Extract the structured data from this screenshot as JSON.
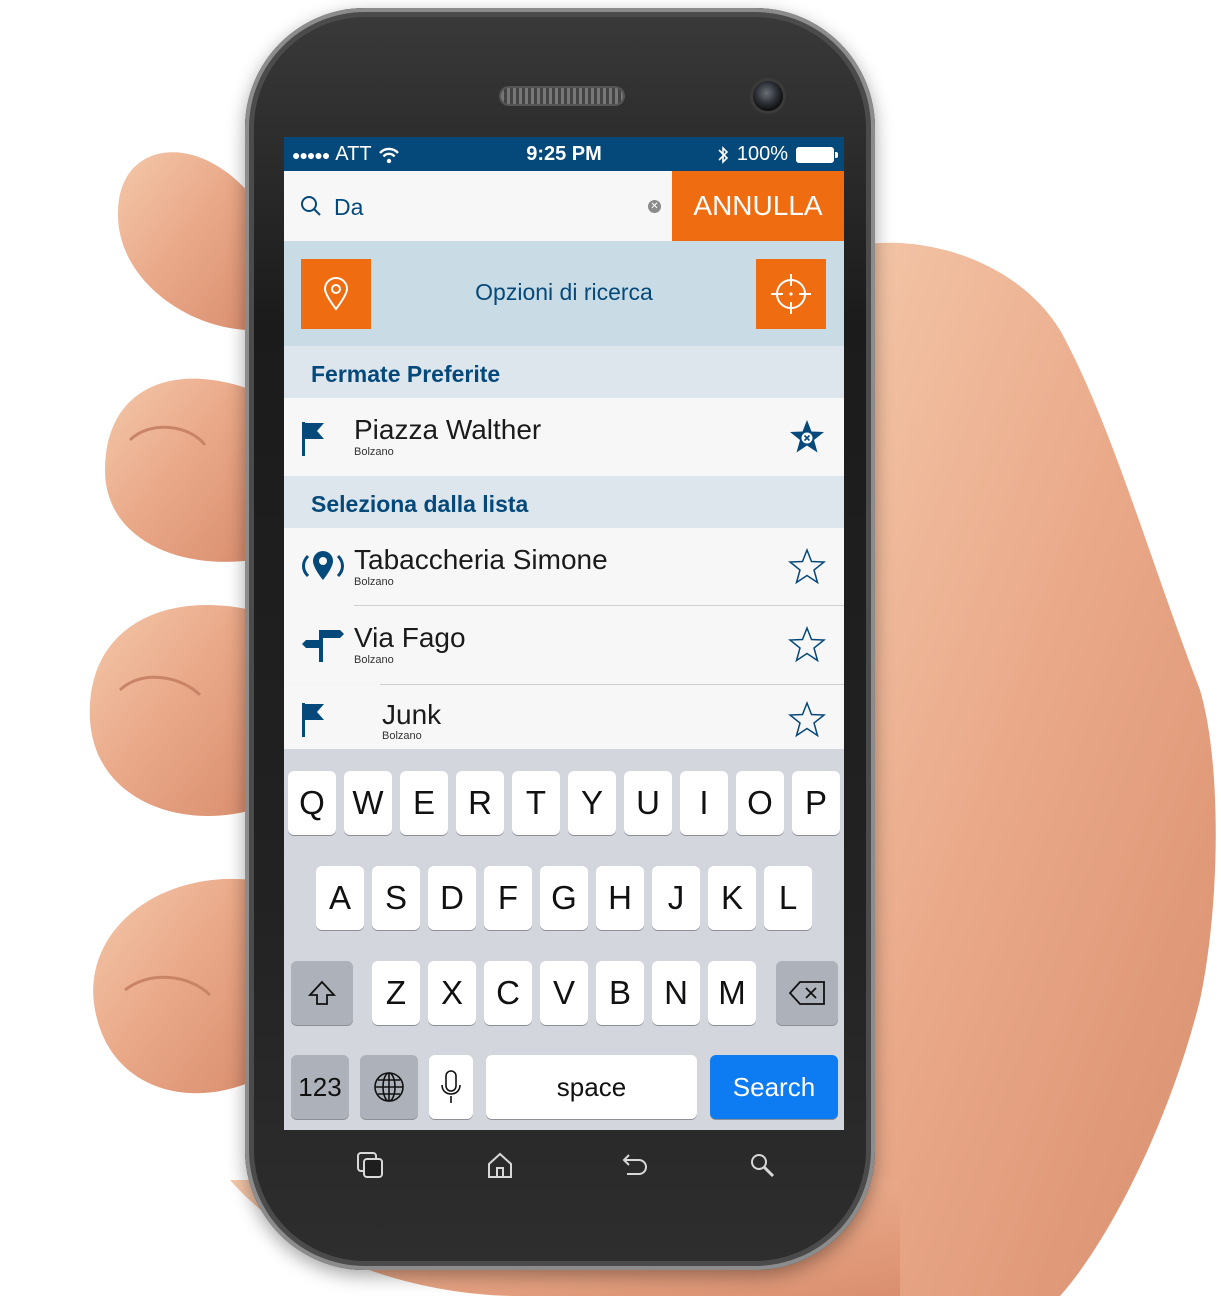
{
  "status_bar": {
    "carrier": "ATT",
    "time": "9:25 PM",
    "battery": "100%"
  },
  "search": {
    "query": "Da",
    "cancel_label": "ANNULLA"
  },
  "search_options": {
    "label": "Opzioni di ricerca"
  },
  "favorites": {
    "header": "Fermate Preferite",
    "items": [
      {
        "title": "Piazza Walther",
        "city": "Bolzano",
        "icon": "flag-icon",
        "starred": true
      }
    ]
  },
  "list": {
    "header": "Seleziona dalla lista",
    "items": [
      {
        "title": "Tabaccheria Simone",
        "city": "Bolzano",
        "icon": "ticket-point-icon"
      },
      {
        "title": "Via Fago",
        "city": "Bolzano",
        "icon": "signpost-icon"
      },
      {
        "title": "Junk",
        "city": "Bolzano",
        "icon": "flag-icon"
      }
    ]
  },
  "keyboard": {
    "row1": [
      "Q",
      "W",
      "E",
      "R",
      "T",
      "Y",
      "U",
      "I",
      "O",
      "P"
    ],
    "row2": [
      "A",
      "S",
      "D",
      "F",
      "G",
      "H",
      "J",
      "K",
      "L"
    ],
    "row3": [
      "Z",
      "X",
      "C",
      "V",
      "B",
      "N",
      "M"
    ],
    "numbers_label": "123",
    "space_label": "space",
    "search_label": "Search"
  },
  "colors": {
    "brand_blue": "#05497a",
    "accent_orange": "#f06c10",
    "ios_blue": "#0d7cf2"
  }
}
